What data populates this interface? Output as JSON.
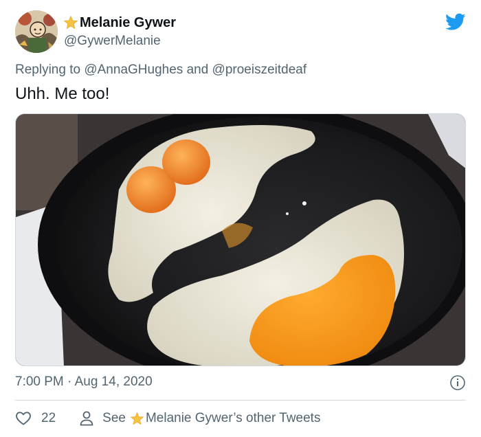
{
  "author": {
    "name": "Melanie Gywer",
    "handle": "@GywerMelanie",
    "avatar_icon": "profile-illustration",
    "name_prefix_icon": "star-emoji"
  },
  "brand_icon": "twitter-bird-icon",
  "colors": {
    "twitter_blue": "#1d9bf0",
    "star_gold": "#f6c343",
    "secondary_text": "#536471",
    "divider": "#cfd9de"
  },
  "reply_context": {
    "prefix": "Replying to",
    "mention_1": "@AnnaGHughes",
    "conjunction": "and",
    "mention_2": "@proeiszeitdeaf"
  },
  "tweet": {
    "text": "Uhh. Me too!",
    "media_description_icon": "photo",
    "timestamp": "7:00 PM · Aug 14, 2020"
  },
  "footer": {
    "like_count": "22",
    "see_prefix": "See",
    "see_suffix": "Melanie Gywer’s other Tweets"
  }
}
